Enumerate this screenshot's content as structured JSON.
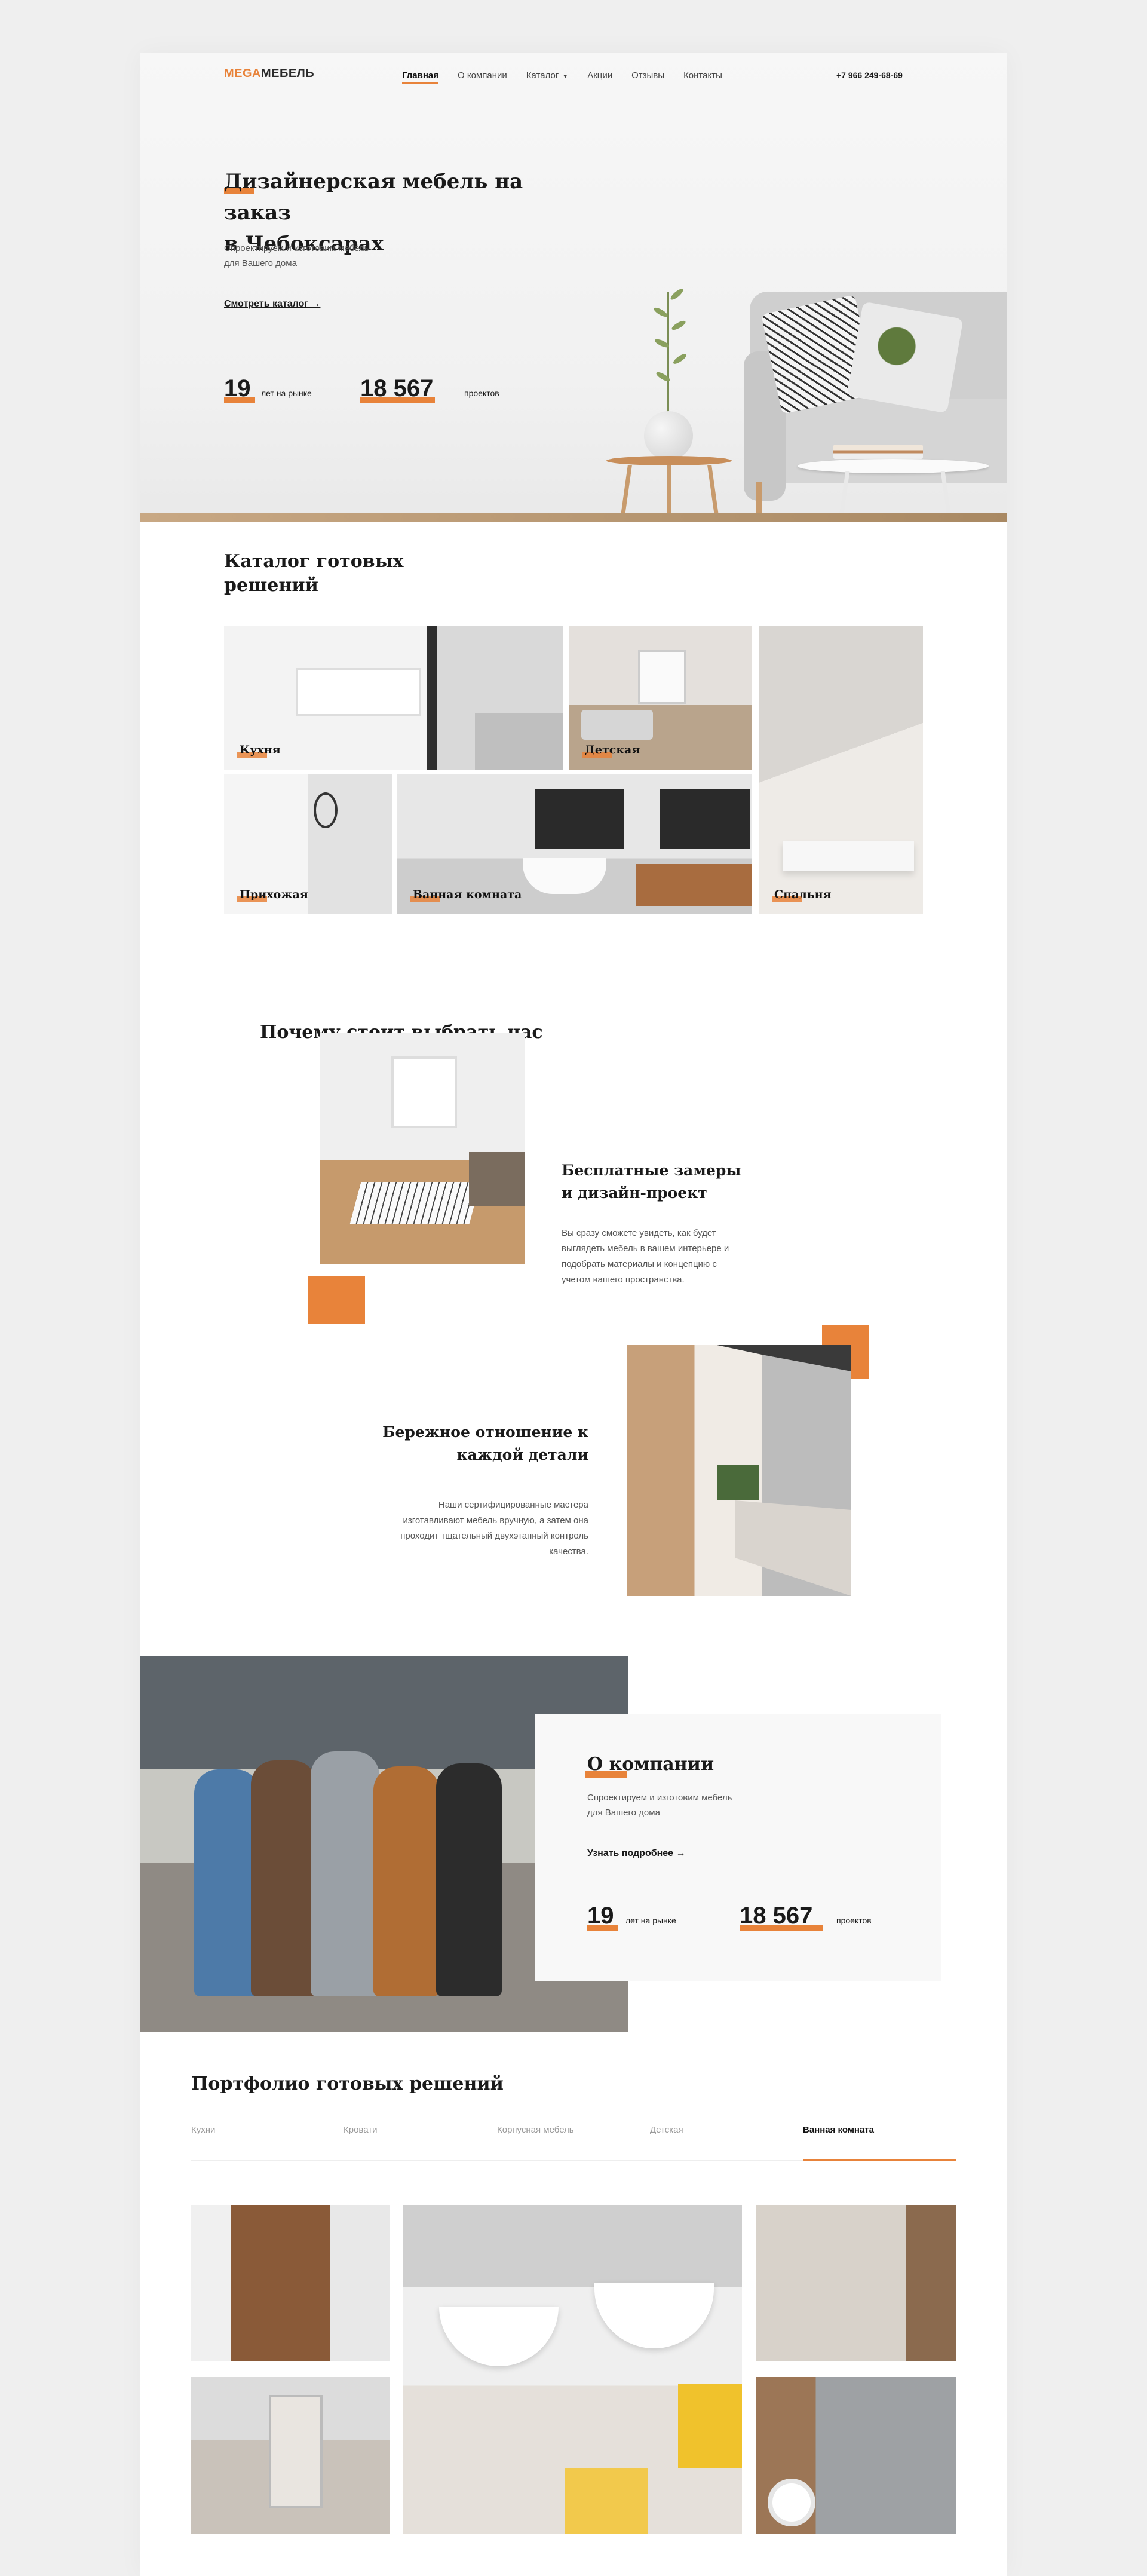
{
  "header": {
    "logo_mega": "MEGA",
    "logo_mebel": "МЕБЕЛЬ",
    "nav": [
      {
        "label": "Главная",
        "active": true
      },
      {
        "label": "О компании"
      },
      {
        "label": "Каталог",
        "dropdown": true
      },
      {
        "label": "Акции"
      },
      {
        "label": "Отзывы"
      },
      {
        "label": "Контакты"
      }
    ],
    "phone": "+7 966 249-68-69"
  },
  "hero": {
    "title_line1": "Дизайнерская мебель на заказ",
    "title_line2": "в Чебоксарах",
    "subtitle_line1": "Спроектируем и изготовим мебель",
    "subtitle_line2": "для Вашего дома",
    "link": "Смотреть каталог →",
    "stats": [
      {
        "value": "19",
        "label": "лет на рынке"
      },
      {
        "value": "18 567",
        "label": "проектов"
      }
    ]
  },
  "catalog": {
    "title_line1": "Каталог готовых",
    "title_line2": "решений",
    "tiles": [
      "Кухня",
      "Детская",
      "Спальня",
      "Прихожая",
      "Ванная комната"
    ]
  },
  "why": {
    "title": "Почему стоит выбрать нас",
    "items": [
      {
        "title_line1": "Бесплатные замеры",
        "title_line2": "и дизайн-проект",
        "text": [
          "Вы сразу сможете увидеть, как будет",
          "выглядеть мебель в вашем интерьере и",
          "подобрать материалы и концепцию с",
          "учетом вашего пространства."
        ]
      },
      {
        "title_line1": "Бережное отношение к",
        "title_line2": "каждой детали",
        "text": [
          "Наши сертифицированные мастера",
          "изготавливают мебель вручную, а затем она",
          "проходит тщательный двухэтапный контроль",
          "качества."
        ]
      }
    ]
  },
  "about": {
    "title": "О компании",
    "subtitle_line1": "Спроектируем и изготовим мебель",
    "subtitle_line2": "для Вашего дома",
    "link": "Узнать подробнее →",
    "stats": [
      {
        "value": "19",
        "label": "лет на рынке"
      },
      {
        "value": "18 567",
        "label": "проектов"
      }
    ]
  },
  "portfolio": {
    "title": "Портфолио готовых решений",
    "tabs": [
      "Кухни",
      "Кровати",
      "Корпусная мебель",
      "Детская",
      "Ванная комната"
    ],
    "active_tab": 4
  },
  "colors": {
    "accent": "#e8833a",
    "text": "#1a1a1a",
    "background": "#efefef"
  }
}
